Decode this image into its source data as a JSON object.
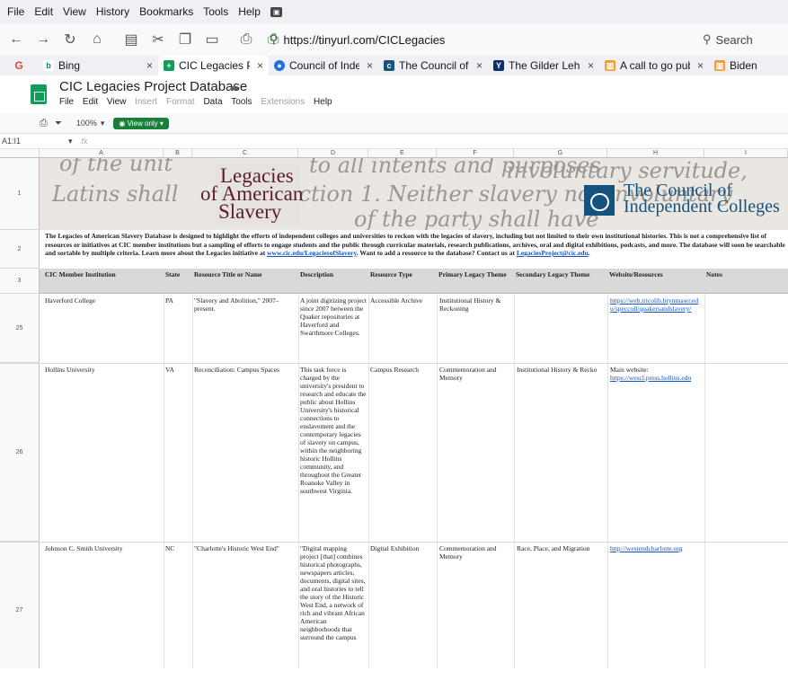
{
  "browser": {
    "menu": [
      "File",
      "Edit",
      "View",
      "History",
      "Bookmarks",
      "Tools",
      "Help"
    ],
    "url": "https://tinyurl.com/CICLegacies",
    "search_placeholder": "Search",
    "tabs": [
      {
        "label": "Bing"
      },
      {
        "label": "CIC Legacies Proj"
      },
      {
        "label": "Council of Indepe"
      },
      {
        "label": "The Council of In"
      },
      {
        "label": "The Gilder Lehrm"
      },
      {
        "label": "A call to go publi"
      },
      {
        "label": "Biden"
      }
    ]
  },
  "sheet": {
    "title": "CIC Legacies Project Database",
    "menu": [
      "File",
      "Edit",
      "View",
      "Insert",
      "Format",
      "Data",
      "Tools",
      "Extensions",
      "Help"
    ],
    "zoom": "100%",
    "view_mode": "View only",
    "cell_ref": "A1:I1",
    "fx": "fx",
    "columns": [
      "A",
      "B",
      "C",
      "D",
      "E",
      "F",
      "G",
      "H",
      "I"
    ],
    "row_numbers": [
      "1",
      "2",
      "3",
      "25",
      "26",
      "27"
    ]
  },
  "banner": {
    "legacies_line1": "Legacies",
    "legacies_line2": "of American",
    "legacies_line3": "Slavery",
    "cic_line1": "The Council of",
    "cic_line2": "Independent Colleges",
    "script_lines": [
      "of the unit",
      "to all intents and purposes",
      "involuntary servitude,",
      "Latins shall",
      "Section 1.  Neither slavery nor involuntary",
      "shall have",
      "of the party shall have"
    ]
  },
  "intro": {
    "text": "The Legacies of American Slavery Database is designed to highlight the efforts of independent colleges and universities to reckon with the legacies of slavery, including but not limited to their own institutional histories. This is not a comprehensive list of resources or initiatives at CIC member institutions but a sampling of efforts to engage students and the public through curricular materials, research publications, archives, oral and digital exhibitions, podcasts, and more. The database will soon be searchable and sortable by multiple criteria. Learn more about the Legacies initiative at ",
    "link1": "www.cic.edu/LegaciesofSlavery",
    "text2": ". Want to add a resource to the database? Contact us at ",
    "link2": "LegaciesProject@cic.edu",
    "text3": "."
  },
  "headers": [
    "CIC Member Institution",
    "State",
    "Resource Title or Name",
    "Description",
    "Resource Type",
    "Primary Legacy Theme",
    "Secondary Legacy Theme",
    "Website/Resources",
    "Notes"
  ],
  "rows": [
    {
      "institution": "Haverford College",
      "state": "PA",
      "title": "\"Slavery and Abolition,\" 2007–present.",
      "description": "A joint digitizing project since 2007 between the Quaker repositories at Haverford and Swarthmore Colleges.",
      "type": "Accessible Archive",
      "primary": "Institutional History & Reckoning",
      "secondary": "",
      "website": "https://web.tricolib.brynmawr.edu/speccoll/quakersandslavery/",
      "notes": ""
    },
    {
      "institution": "Hollins University",
      "state": "VA",
      "title": "Reconciliation: Campus Spaces",
      "description": "This task force is charged by the university's president to research and educate the public about Hollins University's historical connections to enslavement and the contemporary legacies of slavery on campus, within the neighboring historic Hollins community, and throughout the Greater Roanoke Valley in southwest Virginia.",
      "type": "Campus Research",
      "primary": "Commemoration and Memory",
      "secondary": "Institutional History & Recko",
      "website_prefix": "Main website:",
      "website": "https://wescl.press.hollins.edu",
      "notes": ""
    },
    {
      "institution": "Johnson C. Smith University",
      "state": "NC",
      "title": "\"Charlotte's Historic West End\"",
      "description": "\"Digital mapping project [that] combines historical photographs, newspapers articles, documents, digital sites, and oral histories to tell the story of the Historic West End, a network of rich and vibrant African American neighborhoods that surround the campus",
      "type": "Digital Exhibition",
      "primary": "Commemoration and Memory",
      "secondary": "Race, Place, and Migration",
      "website": "http://westendcharlotte.org",
      "notes": ""
    }
  ]
}
